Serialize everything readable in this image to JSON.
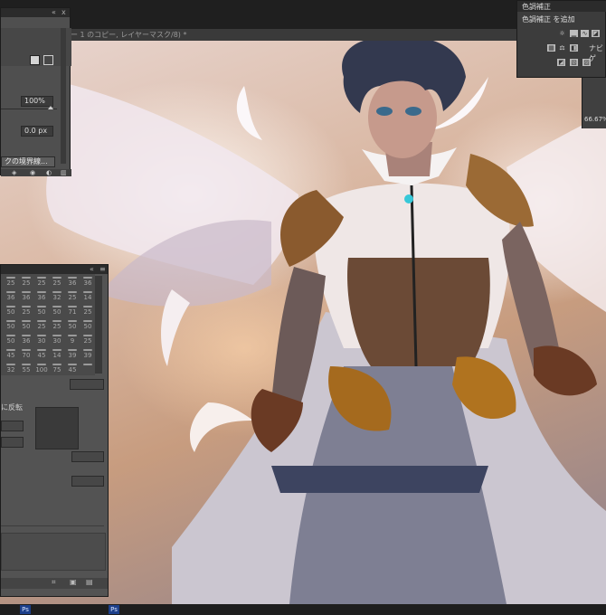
{
  "document": {
    "tab_title": "ー 1 のコピー, レイヤーマスク/8) *"
  },
  "properties_panel": {
    "collapse_glyph": "«",
    "close_glyph": "x",
    "density_value": "100%",
    "feather_value": "0.0 px",
    "mask_edge_button": "クの境界線..."
  },
  "brush_panel": {
    "collapse_glyph": "«",
    "menu_glyph": "≡",
    "brush_sizes": [
      [
        "25",
        "25",
        "25",
        "25",
        "36",
        "36"
      ],
      [
        "36",
        "36",
        "36",
        "32",
        "25",
        "14"
      ],
      [
        "50",
        "25",
        "50",
        "50",
        "71",
        "25"
      ],
      [
        "50",
        "50",
        "25",
        "25",
        "50",
        "50"
      ],
      [
        "50",
        "36",
        "30",
        "30",
        "9",
        "25"
      ],
      [
        "45",
        "70",
        "45",
        "14",
        "39",
        "39"
      ],
      [
        "32",
        "55",
        "100",
        "75",
        "45",
        ""
      ]
    ],
    "flip_label": "に反転"
  },
  "adjustments_panel": {
    "tab_label": "色調補正",
    "add_label": "色調補正 を追加",
    "nav_partial_label": "ナビゲ",
    "zoom_value": "66.67%"
  },
  "status": {
    "item1_icon": "Ps",
    "item2_icon": "Ps"
  }
}
